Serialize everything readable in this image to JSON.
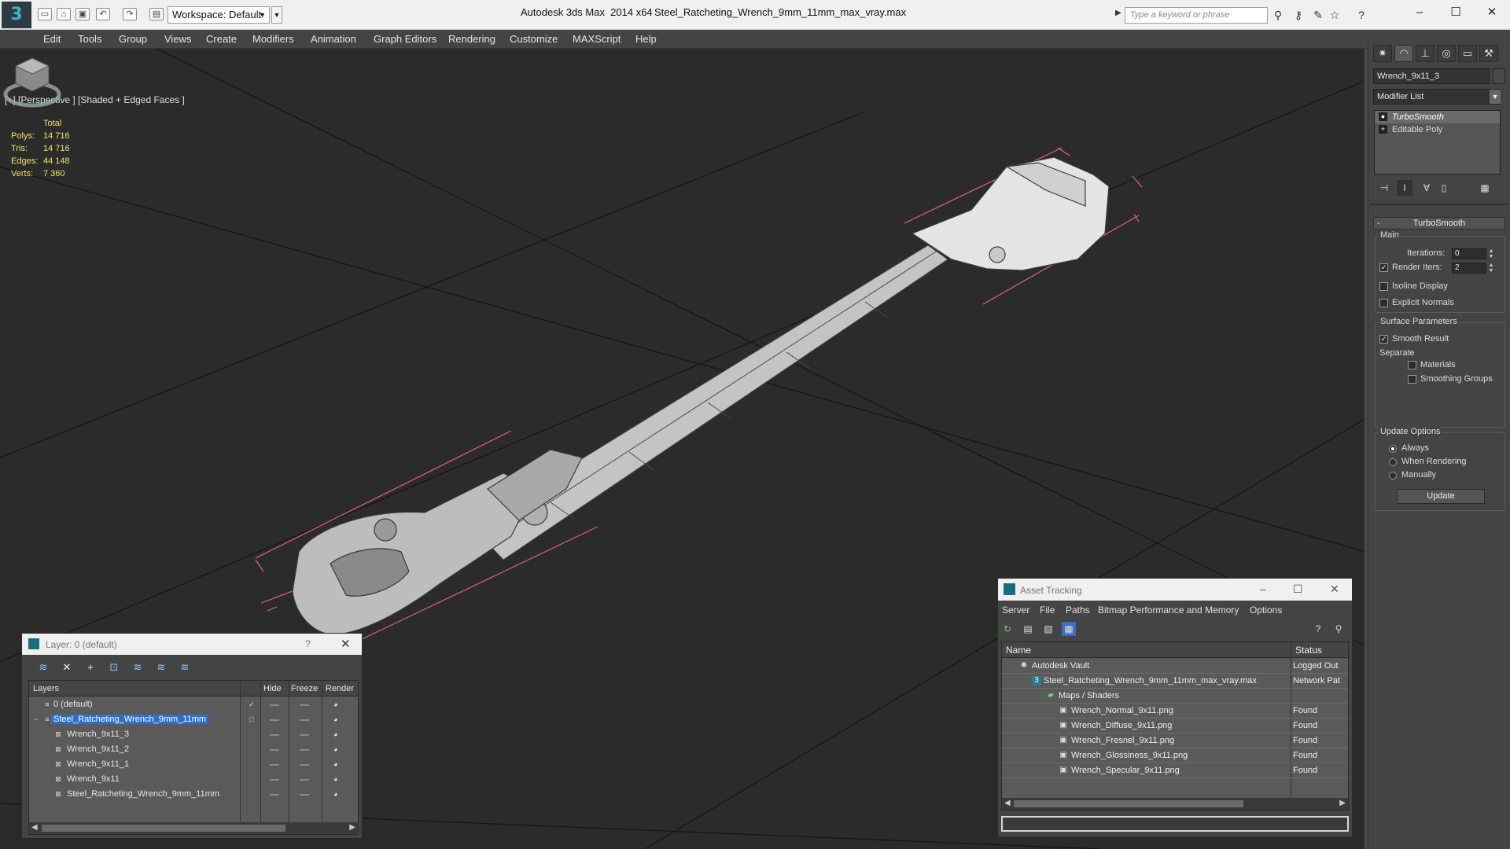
{
  "titlebar": {
    "app_title": "Autodesk 3ds Max  2014 x64",
    "document_title": "Steel_Ratcheting_Wrench_9mm_11mm_max_vray.max",
    "workspace": "Workspace: Default",
    "search_placeholder": "Type a keyword or phrase",
    "minimize": "–",
    "maximize": "☐",
    "close": "✕"
  },
  "menu": [
    "Edit",
    "Tools",
    "Group",
    "Views",
    "Create",
    "Modifiers",
    "Animation",
    "Graph Editors",
    "Rendering",
    "Customize",
    "MAXScript",
    "Help"
  ],
  "viewport": {
    "label": "[+] [Perspective ] [Shaded + Edged Faces ]",
    "stats": {
      "total_label": "Total",
      "polys_label": "Polys:",
      "polys": "14 716",
      "tris_label": "Tris:",
      "tris": "14 716",
      "edges_label": "Edges:",
      "edges": "44 148",
      "verts_label": "Verts:",
      "verts": "7 360"
    },
    "stats_color": "#f0e070",
    "selection_color": "#e06080"
  },
  "command_panel": {
    "object_name": "Wrench_9x11_3",
    "modifier_list": "Modifier List",
    "stack": [
      "TurboSmooth",
      "Editable Poly"
    ],
    "rollout_title": "TurboSmooth",
    "main_group": "Main",
    "iterations_label": "Iterations:",
    "iterations_value": "0",
    "render_iters_label": "Render Iters:",
    "render_iters_value": "2",
    "render_iters_checked": true,
    "isoline_display": "Isoline Display",
    "explicit_normals": "Explicit Normals",
    "surface_params_group": "Surface Parameters",
    "smooth_result": "Smooth Result",
    "smooth_result_checked": true,
    "separate_label": "Separate",
    "materials": "Materials",
    "smoothing_groups": "Smoothing Groups",
    "update_options_group": "Update Options",
    "always": "Always",
    "when_rendering": "When Rendering",
    "manually": "Manually",
    "update_button": "Update"
  },
  "layer_dialog": {
    "title": "Layer: 0 (default)",
    "help": "?",
    "columns": [
      "Layers",
      "Hide",
      "Freeze",
      "Render"
    ],
    "rows": [
      {
        "name": "0 (default)"
      },
      {
        "name": "Steel_Ratcheting_Wrench_9mm_11mm"
      },
      {
        "name": "Wrench_9x11_3"
      },
      {
        "name": "Wrench_9x11_2"
      },
      {
        "name": "Wrench_9x11_1"
      },
      {
        "name": "Wrench_9x11"
      },
      {
        "name": "Steel_Ratcheting_Wrench_9mm_11mm"
      }
    ]
  },
  "asset_dialog": {
    "title": "Asset Tracking",
    "menu": [
      "Server",
      "File",
      "Paths",
      "Bitmap Performance and Memory",
      "Options"
    ],
    "columns": [
      "Name",
      "Status"
    ],
    "rows": [
      {
        "name": "Autodesk Vault",
        "status": "Logged Out"
      },
      {
        "name": "Steel_Ratcheting_Wrench_9mm_11mm_max_vray.max",
        "status": "Network Pat"
      },
      {
        "name": "Maps / Shaders",
        "status": ""
      },
      {
        "name": "Wrench_Normal_9x11.png",
        "status": "Found"
      },
      {
        "name": "Wrench_Diffuse_9x11.png",
        "status": "Found"
      },
      {
        "name": "Wrench_Fresnel_9x11.png",
        "status": "Found"
      },
      {
        "name": "Wrench_Glossiness_9x11.png",
        "status": "Found"
      },
      {
        "name": "Wrench_Specular_9x11.png",
        "status": "Found"
      }
    ]
  }
}
